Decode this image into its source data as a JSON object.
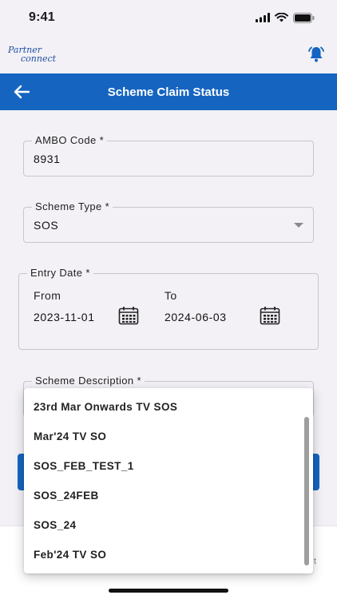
{
  "status_bar": {
    "time": "9:41"
  },
  "app": {
    "logo_line1": "Partner",
    "logo_line2": "connect"
  },
  "header": {
    "title": "Scheme Claim Status"
  },
  "form": {
    "ambo_code": {
      "label": "AMBO Code *",
      "value": "8931"
    },
    "scheme_type": {
      "label": "Scheme Type *",
      "value": "SOS"
    },
    "entry_date": {
      "label": "Entry Date *",
      "from_label": "From",
      "from_value": "2023-11-01",
      "to_label": "To",
      "to_value": "2024-06-03"
    },
    "scheme_description": {
      "label": "Scheme Description *"
    }
  },
  "dropdown": {
    "options": [
      "23rd Mar Onwards TV SOS",
      "Mar'24 TV SO",
      "SOS_FEB_TEST_1",
      "SOS_24FEB",
      "SOS_24",
      "Feb'24 TV SO"
    ]
  },
  "bottom": {
    "partial_text": "t"
  },
  "colors": {
    "primary": "#1565c0",
    "background": "#f3f1f6",
    "border": "#c9c5cf"
  }
}
